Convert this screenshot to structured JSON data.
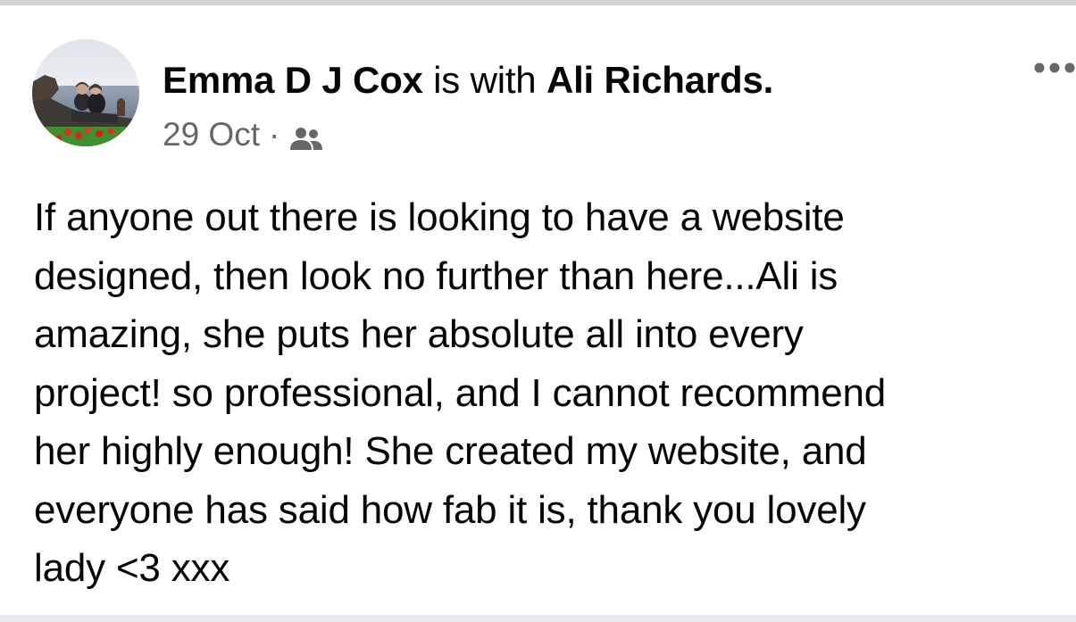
{
  "post": {
    "author_name": "Emma D J Cox",
    "with_text": " is with ",
    "tagged_name": "Ali Richards",
    "tagged_suffix": ".",
    "date": "29 Oct",
    "separator": "·",
    "audience_icon": "friends-icon",
    "more_icon": "more-options-icon",
    "body": "If anyone out there is looking to have a website\ndesigned, then look no further than here...Ali is\namazing, she puts her absolute all into every\nproject!  so professional, and I cannot recommend\nher highly enough!  She created my website, and\neveryone has said how fab it is, thank you lovely\nlady <3 xxx"
  },
  "colors": {
    "text_primary": "#050505",
    "text_secondary": "#65676b",
    "divider": "#cfd1d6"
  }
}
